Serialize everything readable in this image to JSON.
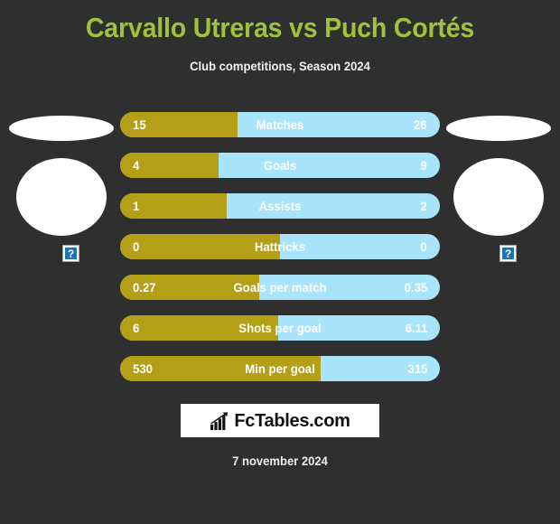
{
  "header": {
    "title": "Carvallo Utreras vs Puch Cortés",
    "subtitle": "Club competitions, Season 2024",
    "title_color": "#9fc13c"
  },
  "players": {
    "home": {
      "image_status": "broken-image",
      "placeholder_glyph": "?"
    },
    "away": {
      "image_status": "broken-image",
      "placeholder_glyph": "?"
    }
  },
  "colors": {
    "background": "#2f2f2f",
    "home_bar": "#b59f16",
    "away_bar": "#a8e4fb",
    "value_text": "#ffffff"
  },
  "stats": [
    {
      "label": "Matches",
      "home": "15",
      "away": "26",
      "home_pct": 36.6
    },
    {
      "label": "Goals",
      "home": "4",
      "away": "9",
      "home_pct": 30.8
    },
    {
      "label": "Assists",
      "home": "1",
      "away": "2",
      "home_pct": 33.3
    },
    {
      "label": "Hattricks",
      "home": "0",
      "away": "0",
      "home_pct": 50.0
    },
    {
      "label": "Goals per match",
      "home": "0.27",
      "away": "0.35",
      "home_pct": 43.5
    },
    {
      "label": "Shots per goal",
      "home": "6",
      "away": "6.11",
      "home_pct": 49.5
    },
    {
      "label": "Min per goal",
      "home": "530",
      "away": "315",
      "home_pct": 62.7
    }
  ],
  "footer": {
    "logo_text": "FcTables.com",
    "logo_icon": "bar-chart-growth-icon",
    "date": "7 november 2024"
  }
}
